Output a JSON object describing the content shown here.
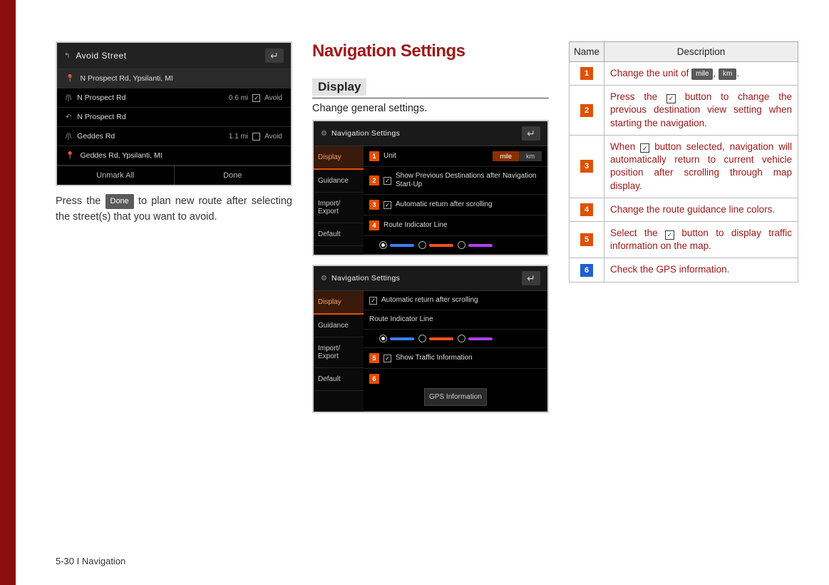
{
  "screen1": {
    "title": "Avoid Street",
    "rows": [
      {
        "icon": "pin",
        "label": "N Prospect Rd, Ypsilanti, MI",
        "selected": true
      },
      {
        "icon": "road",
        "label": "N Prospect Rd",
        "meta": "0.6 mi",
        "checked": true,
        "avoid": "Avoid"
      },
      {
        "icon": "back",
        "label": "N Prospect Rd"
      },
      {
        "icon": "road",
        "label": "Geddes Rd",
        "meta": "1.1 mi",
        "checked": false,
        "avoid": "Avoid"
      },
      {
        "icon": "pin",
        "label": "Geddes Rd, Ypsilanti, MI"
      }
    ],
    "footer_left": "Unmark All",
    "footer_right": "Done"
  },
  "caption1_pre": "Press the ",
  "caption1_btn": "Done",
  "caption1_post": " to plan new route after selecting the street(s) that you want to avoid.",
  "heading": "Navigation Settings",
  "subheading": "Display",
  "subcaption": "Change general settings.",
  "screen2a": {
    "title": "Navigation Settings",
    "side": [
      "Display",
      "Guidance",
      "Import/\nExport",
      "Default"
    ],
    "rows": [
      {
        "num": "1",
        "label": "Unit",
        "unit_active": "mile",
        "unit_other": "km"
      },
      {
        "num": "2",
        "chk": true,
        "label": "Show Previous Destinations after Navigation Start-Up"
      },
      {
        "num": "3",
        "chk": true,
        "label": "Automatic return after scrolling"
      },
      {
        "num": "4",
        "label": "Route Indicator Line"
      }
    ],
    "colors": [
      "#3a80ff",
      "#ff5020",
      "#b040ff"
    ]
  },
  "screen2b": {
    "title": "Navigation Settings",
    "side": [
      "Display",
      "Guidance",
      "Import/\nExport",
      "Default"
    ],
    "rows": [
      {
        "chk": true,
        "label": "Automatic return after scrolling"
      },
      {
        "label": "Route Indicator Line"
      },
      {
        "num": "5",
        "chk": true,
        "label": "Show Traffic Information"
      },
      {
        "num": "6",
        "gps": "GPS Information"
      }
    ],
    "colors": [
      "#3a80ff",
      "#ff5020",
      "#b040ff"
    ]
  },
  "table": {
    "head_name": "Name",
    "head_desc": "Description",
    "rows": [
      {
        "n": "1",
        "d_pre": "Change the unit of ",
        "b1": "mile",
        "mid": ", ",
        "b2": "km",
        "d_post": "."
      },
      {
        "n": "2",
        "d_pre": "Press the ",
        "chk": true,
        "d_post": " button to change the previous destination view setting when starting the navigation."
      },
      {
        "n": "3",
        "d_pre": "When ",
        "chk": true,
        "d_post": " button selected, navigation will automatically return to current vehicle position after scrolling through map display."
      },
      {
        "n": "4",
        "d": "Change the route guidance line colors."
      },
      {
        "n": "5",
        "d_pre": "Select the ",
        "chk": true,
        "d_post": " button to display traffic information on the map."
      },
      {
        "n": "6",
        "blue": true,
        "d": "Check the GPS information."
      }
    ]
  },
  "footer": "5-30 I Navigation"
}
